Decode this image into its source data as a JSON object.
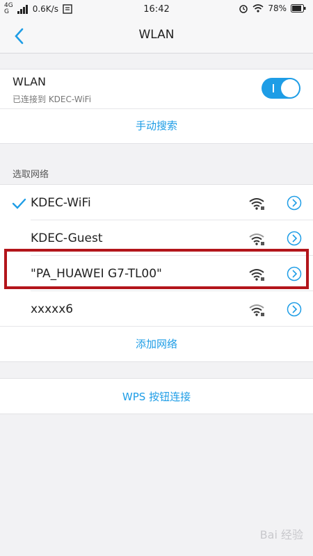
{
  "status_bar": {
    "network_type": "4G",
    "network_type2": "G",
    "speed": "0.6K/s",
    "time": "16:42",
    "battery": "78%"
  },
  "header": {
    "title": "WLAN"
  },
  "wlan": {
    "label": "WLAN",
    "status": "已连接到 KDEC-WiFi",
    "toggle_on": true,
    "manual_search": "手动搜索"
  },
  "networks_section": {
    "label": "选取网络",
    "items": [
      {
        "name": "KDEC-WiFi",
        "connected": true
      },
      {
        "name": "KDEC-Guest",
        "connected": false
      },
      {
        "name": "\"PA_HUAWEI G7-TL00\"",
        "connected": false
      },
      {
        "name": "xxxxx6",
        "connected": false
      }
    ],
    "add_network": "添加网络"
  },
  "wps": {
    "label": "WPS 按钮连接"
  },
  "watermark": {
    "text": "Bai 经验"
  },
  "colors": {
    "accent": "#1e9de6",
    "highlight": "#b3151b"
  }
}
